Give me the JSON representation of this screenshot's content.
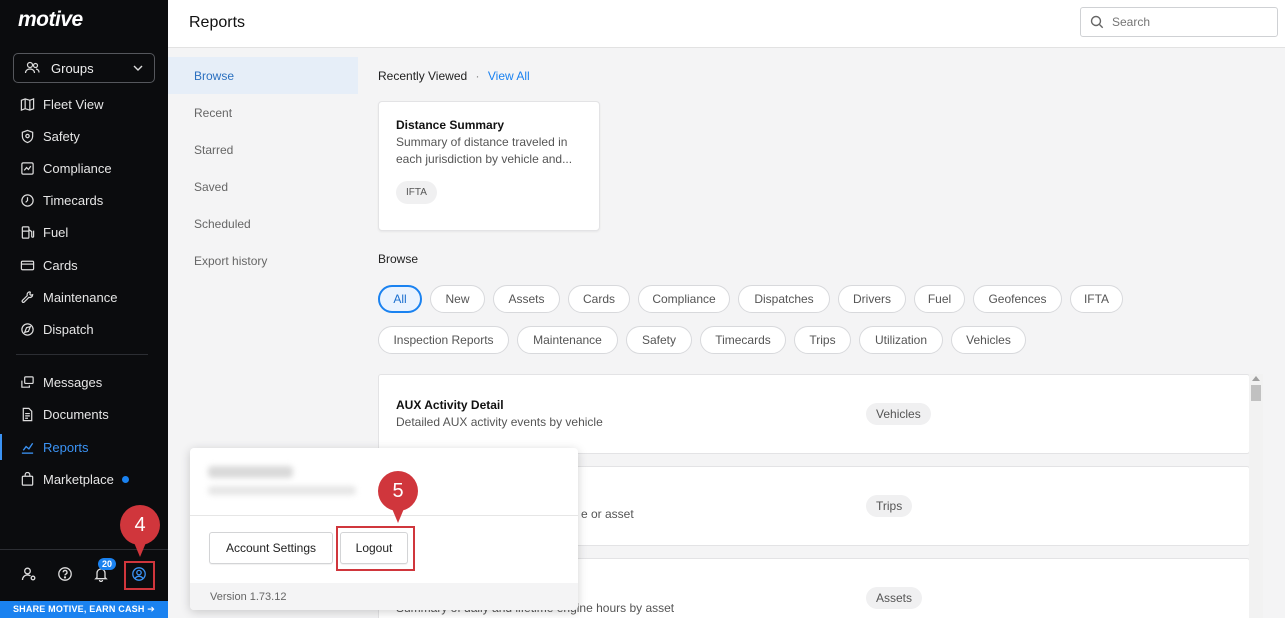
{
  "sidebar": {
    "logo": "motive",
    "groups_label": "Groups",
    "items": [
      {
        "label": "Fleet View",
        "icon": "map-icon"
      },
      {
        "label": "Safety",
        "icon": "shield-icon"
      },
      {
        "label": "Compliance",
        "icon": "compliance-icon"
      },
      {
        "label": "Timecards",
        "icon": "clock-icon"
      },
      {
        "label": "Fuel",
        "icon": "fuel-icon"
      },
      {
        "label": "Cards",
        "icon": "card-icon"
      },
      {
        "label": "Maintenance",
        "icon": "wrench-icon"
      },
      {
        "label": "Dispatch",
        "icon": "dispatch-icon"
      },
      {
        "label": "Messages",
        "icon": "message-icon"
      },
      {
        "label": "Documents",
        "icon": "document-icon"
      },
      {
        "label": "Reports",
        "icon": "chart-icon",
        "active": true
      },
      {
        "label": "Marketplace",
        "icon": "bag-icon",
        "dot": true
      }
    ],
    "notification_count": "20",
    "promo": "SHARE MOTIVE, EARN CASH ➔"
  },
  "header": {
    "title": "Reports",
    "search_placeholder": "Search"
  },
  "subnav": {
    "items": [
      "Browse",
      "Recent",
      "Starred",
      "Saved",
      "Scheduled",
      "Export history"
    ],
    "active": "Browse"
  },
  "main": {
    "recently_viewed_label": "Recently Viewed",
    "separator": "·",
    "view_all": "View All",
    "recent_card": {
      "title": "Distance Summary",
      "description": "Summary of distance traveled in each jurisdiction by vehicle and...",
      "tag": "IFTA"
    },
    "browse_label": "Browse",
    "chips_row1": [
      "All",
      "New",
      "Assets",
      "Cards",
      "Compliance",
      "Dispatches",
      "Drivers",
      "Fuel",
      "Geofences",
      "IFTA"
    ],
    "chips_row2": [
      "Inspection Reports",
      "Maintenance",
      "Safety",
      "Timecards",
      "Trips",
      "Utilization",
      "Vehicles"
    ],
    "active_chip": "All",
    "reports": [
      {
        "title": "AUX Activity Detail",
        "description": "Detailed AUX activity events by vehicle",
        "tag": "Vehicles"
      },
      {
        "title": "",
        "description": "e or asset",
        "tag": "Trips"
      },
      {
        "title": "",
        "description": "Summary of daily and lifetime engine hours by asset",
        "tag": "Assets"
      }
    ]
  },
  "popup": {
    "account_settings": "Account Settings",
    "logout": "Logout",
    "version": "Version 1.73.12"
  },
  "annotations": {
    "step4": "4",
    "step5": "5",
    "color": "#d0363c"
  },
  "colors": {
    "accent": "#1a82f0",
    "sidebar_bg": "#0b0c0e"
  }
}
